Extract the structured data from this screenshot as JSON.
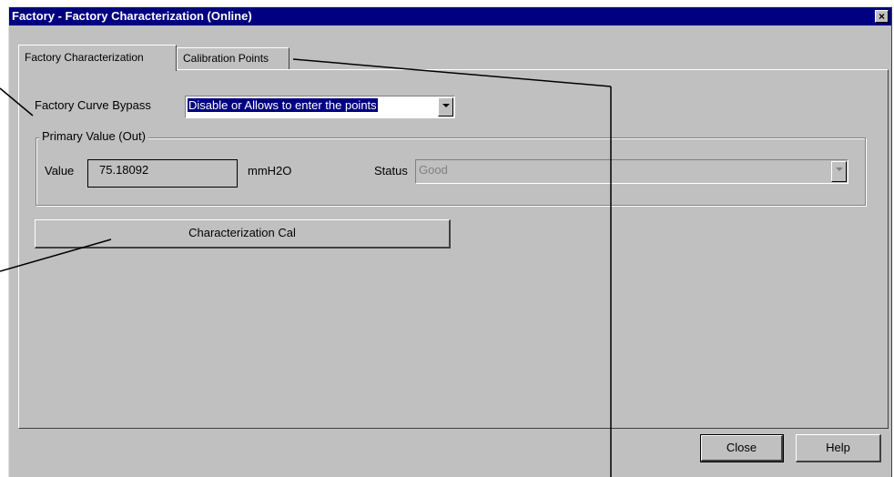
{
  "window": {
    "title": "Factory - Factory Characterization  (Online)"
  },
  "tabs": [
    {
      "label": "Factory Characterization",
      "active": true
    },
    {
      "label": "Calibration Points",
      "active": false
    }
  ],
  "bypass": {
    "label": "Factory Curve Bypass",
    "value": "Disable or Allows to enter the points"
  },
  "primary_value": {
    "group_title": "Primary Value (Out)",
    "value_label": "Value",
    "value": "75.18092",
    "unit": "mmH2O",
    "status_label": "Status",
    "status_value": "Good"
  },
  "buttons": {
    "characterization": "Characterization Cal",
    "close": "Close",
    "help": "Help"
  },
  "icons": {
    "close_window": "close-icon",
    "dropdown": "chevron-down-icon"
  },
  "colors": {
    "titlebar": "#000080",
    "face": "#c0c0c0",
    "selection": "#000080"
  }
}
